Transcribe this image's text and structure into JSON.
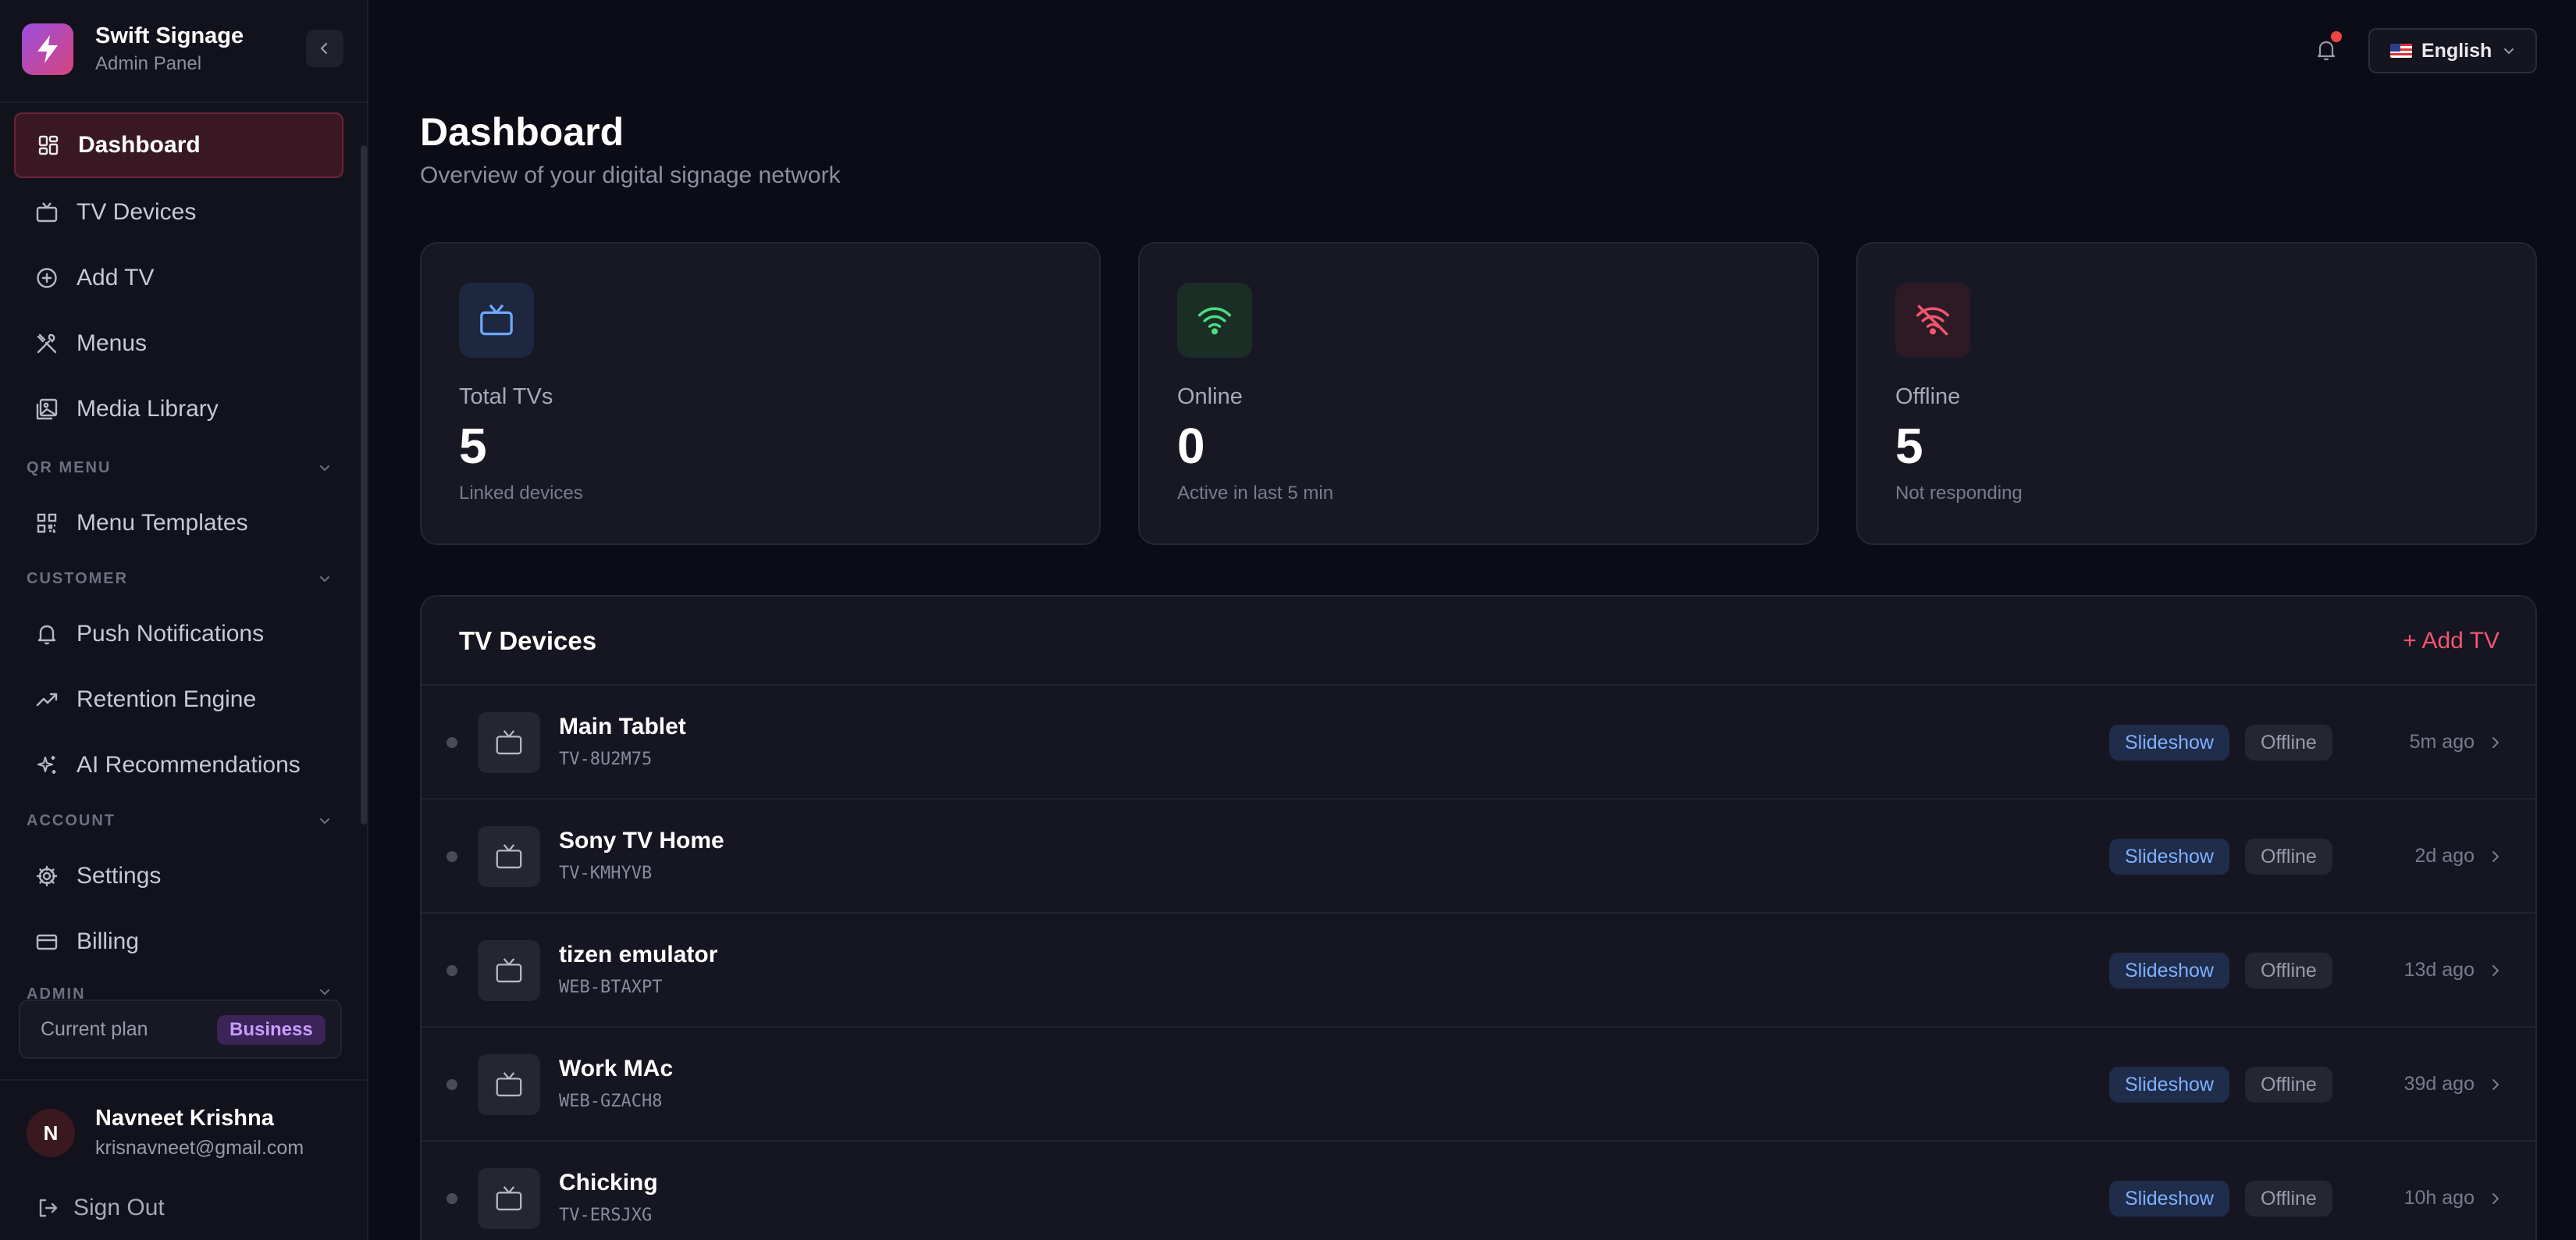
{
  "brand": {
    "title": "Swift Signage",
    "subtitle": "Admin Panel"
  },
  "sidebar": {
    "items": [
      {
        "label": "Dashboard",
        "icon": "dashboard-icon",
        "active": true
      },
      {
        "label": "TV Devices",
        "icon": "tv-icon"
      },
      {
        "label": "Add TV",
        "icon": "plus-circle-icon"
      },
      {
        "label": "Menus",
        "icon": "utensils-icon"
      },
      {
        "label": "Media Library",
        "icon": "image-icon"
      },
      {
        "label": "Menu Templates",
        "icon": "qr-code-icon"
      },
      {
        "label": "Push Notifications",
        "icon": "bell-icon"
      },
      {
        "label": "Retention Engine",
        "icon": "trending-up-icon"
      },
      {
        "label": "AI Recommendations",
        "icon": "sparkles-icon"
      },
      {
        "label": "Settings",
        "icon": "gear-icon"
      },
      {
        "label": "Billing",
        "icon": "credit-card-icon"
      }
    ],
    "sections": [
      "QR MENU",
      "CUSTOMER",
      "ACCOUNT",
      "ADMIN"
    ],
    "plan": {
      "label": "Current plan",
      "value": "Business"
    },
    "user": {
      "initial": "N",
      "name": "Navneet Krishna",
      "email": "krisnavneet@gmail.com"
    },
    "signout_label": "Sign Out"
  },
  "topbar": {
    "language": "English"
  },
  "header": {
    "title": "Dashboard",
    "subtitle": "Overview of your digital signage network"
  },
  "stats": [
    {
      "label": "Total TVs",
      "value": "5",
      "sub": "Linked devices",
      "icon": "tv-icon",
      "color": "#6ea8ff"
    },
    {
      "label": "Online",
      "value": "0",
      "sub": "Active in last 5 min",
      "icon": "wifi-icon",
      "color": "#4ade80"
    },
    {
      "label": "Offline",
      "value": "5",
      "sub": "Not responding",
      "icon": "wifi-off-icon",
      "color": "#f0556f"
    }
  ],
  "devices": {
    "title": "TV Devices",
    "add_label": "+ Add TV",
    "rows": [
      {
        "name": "Main Tablet",
        "code": "TV-8U2M75",
        "mode": "Slideshow",
        "status": "Offline",
        "time": "5m ago"
      },
      {
        "name": "Sony TV Home",
        "code": "TV-KMHYVB",
        "mode": "Slideshow",
        "status": "Offline",
        "time": "2d ago"
      },
      {
        "name": "tizen emulator",
        "code": "WEB-BTAXPT",
        "mode": "Slideshow",
        "status": "Offline",
        "time": "13d ago"
      },
      {
        "name": "Work MAc",
        "code": "WEB-GZACH8",
        "mode": "Slideshow",
        "status": "Offline",
        "time": "39d ago"
      },
      {
        "name": "Chicking",
        "code": "TV-ERSJXG",
        "mode": "Slideshow",
        "status": "Offline",
        "time": "10h ago"
      }
    ]
  },
  "colors": {
    "accent": "#f0556f",
    "brand_start": "#9b4ee0",
    "brand_end": "#d6457b"
  }
}
